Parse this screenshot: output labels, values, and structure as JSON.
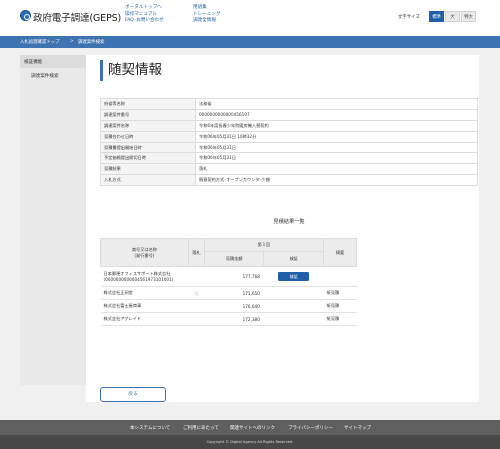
{
  "header": {
    "app_title": "政府電子調達(GEPS)",
    "links_col1": [
      "ポータルトップへ",
      "操作マニュアル",
      "FAQ･お問い合わせ"
    ],
    "links_col2": [
      "用語集",
      "トレーニング",
      "調達全情報"
    ],
    "font_size_label": "文字サイズ",
    "font_sizes": [
      "標準",
      "大",
      "特大"
    ],
    "font_size_selected": "標準"
  },
  "breadcrumb": [
    "入札処理確認トップ",
    "調達案件検索"
  ],
  "breadcrumb_separator": ">",
  "sidebar": {
    "heading": "検証機能",
    "items": [
      "調達案件検索"
    ]
  },
  "page_title": "随契情報",
  "info_rows": [
    {
      "label": "府省等名称",
      "value": "法務省"
    },
    {
      "label": "調達案件番号",
      "value": "0000000000000456197"
    },
    {
      "label": "調達案件名称",
      "value": "令和6年度長春少年院暖房機入替契約"
    },
    {
      "label": "見積合わせ日時",
      "value": "令和06年05月31日 10時32分"
    },
    {
      "label": "見積書提出開始日時",
      "value": "令和06年05月31日"
    },
    {
      "label": "予定価格提出締切日時",
      "value": "令和06年05月31日"
    },
    {
      "label": "見積結果",
      "value": "落札"
    },
    {
      "label": "入札方式",
      "value": "随意契約方式･オープンカウンタ･少額"
    }
  ],
  "results": {
    "title": "見積結果一覧",
    "headers": {
      "vendor": "商号又は名称\n(発行番号)",
      "awarded": "落札",
      "round": "第１回",
      "amount": "見積金額",
      "verify": "検証",
      "remarks": "摘要"
    },
    "rows": [
      {
        "vendor": "日本郵便オフィスサポート株式会社",
        "number": "(0000000000004561973101001)",
        "awarded": "",
        "amount": "177,768",
        "verify": "検証",
        "remarks": ""
      },
      {
        "vendor": "株式会社正岡堂",
        "number": "",
        "awarded": "○",
        "amount": "171,650",
        "verify": "",
        "remarks": "紙見積"
      },
      {
        "vendor": "株式会社富士屋商事",
        "number": "",
        "awarded": "",
        "amount": "176,040",
        "verify": "",
        "remarks": "紙見積"
      },
      {
        "vendor": "株式会社アグレイド",
        "number": "",
        "awarded": "",
        "amount": "172,380",
        "verify": "",
        "remarks": "紙見積"
      }
    ]
  },
  "back_label": "戻る",
  "footer": {
    "links": [
      "本システムについて",
      "ご利用にあたって",
      "関連サイトへのリンク",
      "プライバシーポリシー",
      "サイトマップ"
    ],
    "copyright": "Copyright © Digital Agency All Rights Reserved."
  },
  "colors": {
    "accent": "#1f5fa8",
    "breadcrumb_bg": "#3d73b0",
    "footer_bg": "#5f5f5f",
    "footer_bottom_bg": "#474747"
  }
}
